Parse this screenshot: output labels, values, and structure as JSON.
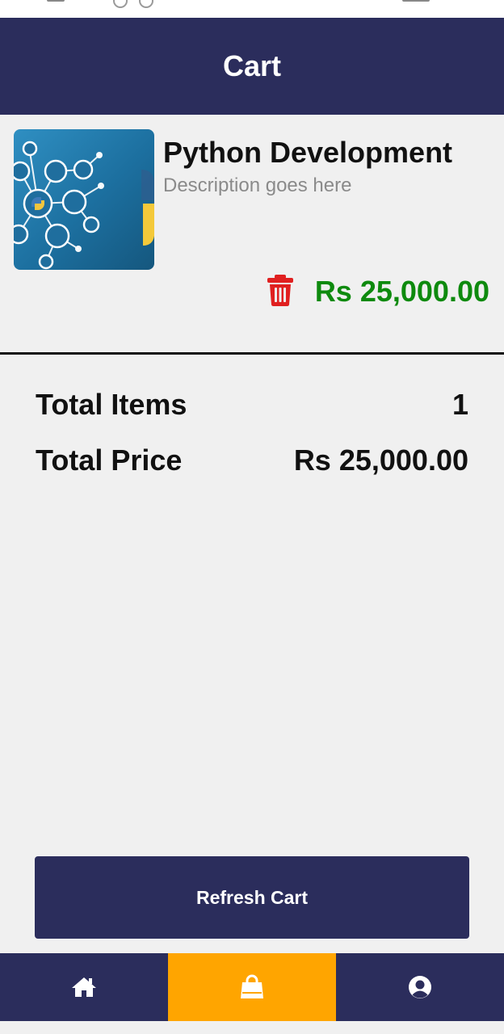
{
  "header": {
    "title": "Cart"
  },
  "cart_item": {
    "title": "Python Development",
    "description": "Description goes here",
    "price": "Rs 25,000.00",
    "thumbnail_icon": "python-network-thumbnail",
    "delete_icon": "trash-icon"
  },
  "summary": {
    "total_items_label": "Total Items",
    "total_items_value": "1",
    "total_price_label": "Total Price",
    "total_price_value": "Rs 25,000.00"
  },
  "refresh_button": {
    "label": "Refresh Cart"
  },
  "bottom_nav": {
    "items": [
      {
        "icon": "home-icon",
        "active": false
      },
      {
        "icon": "shopping-bag-icon",
        "active": true
      },
      {
        "icon": "user-icon",
        "active": false
      }
    ],
    "active_color": "#ffa500",
    "bar_color": "#2b2d5c"
  },
  "colors": {
    "primary": "#2b2d5c",
    "price_green": "#0e8a0e",
    "delete_red": "#e02020",
    "background": "#f0f0f0"
  }
}
